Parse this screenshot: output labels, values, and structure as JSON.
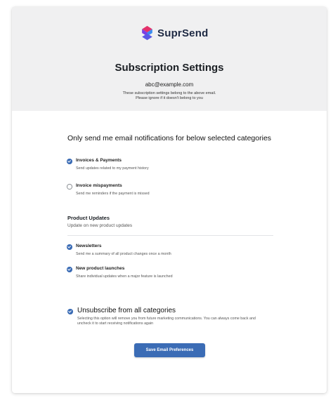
{
  "brand": {
    "name": "SuprSend",
    "logo_icon": "suprsend-logo-icon",
    "colors": [
      "#e4316a",
      "#7b3fe4",
      "#3b8cf0"
    ]
  },
  "header": {
    "title": "Subscription Settings",
    "email": "abc@example.com",
    "note_line1": "These subscription settings belong to the above email.",
    "note_line2": "Please ignore if it doesn't belong to you"
  },
  "main": {
    "heading": "Only send me email notifications for below selected categories",
    "options": [
      {
        "label": "Invoices & Payments",
        "desc": "Send updates related to my payment history",
        "checked": true
      },
      {
        "label": "Invoice mispayments",
        "desc": "Send me reminders if the payment is missed",
        "checked": false
      }
    ],
    "group": {
      "title": "Product Updates",
      "desc": "Update on new product updates",
      "options": [
        {
          "label": "Newsletters",
          "desc": "Send me a summary of all product changes once a month",
          "checked": true
        },
        {
          "label": "New product launches",
          "desc": "Share individual updates when a major feature is launched",
          "checked": true
        }
      ]
    },
    "unsubscribe": {
      "label": "Unsubscribe from all categories",
      "desc": "Selecting this option will remove you from future marketing communications. You can always come back and uncheck it to start receiving notifications again",
      "checked": true
    },
    "save_label": "Save Email Preferences"
  },
  "accent_color": "#3b6cb5"
}
